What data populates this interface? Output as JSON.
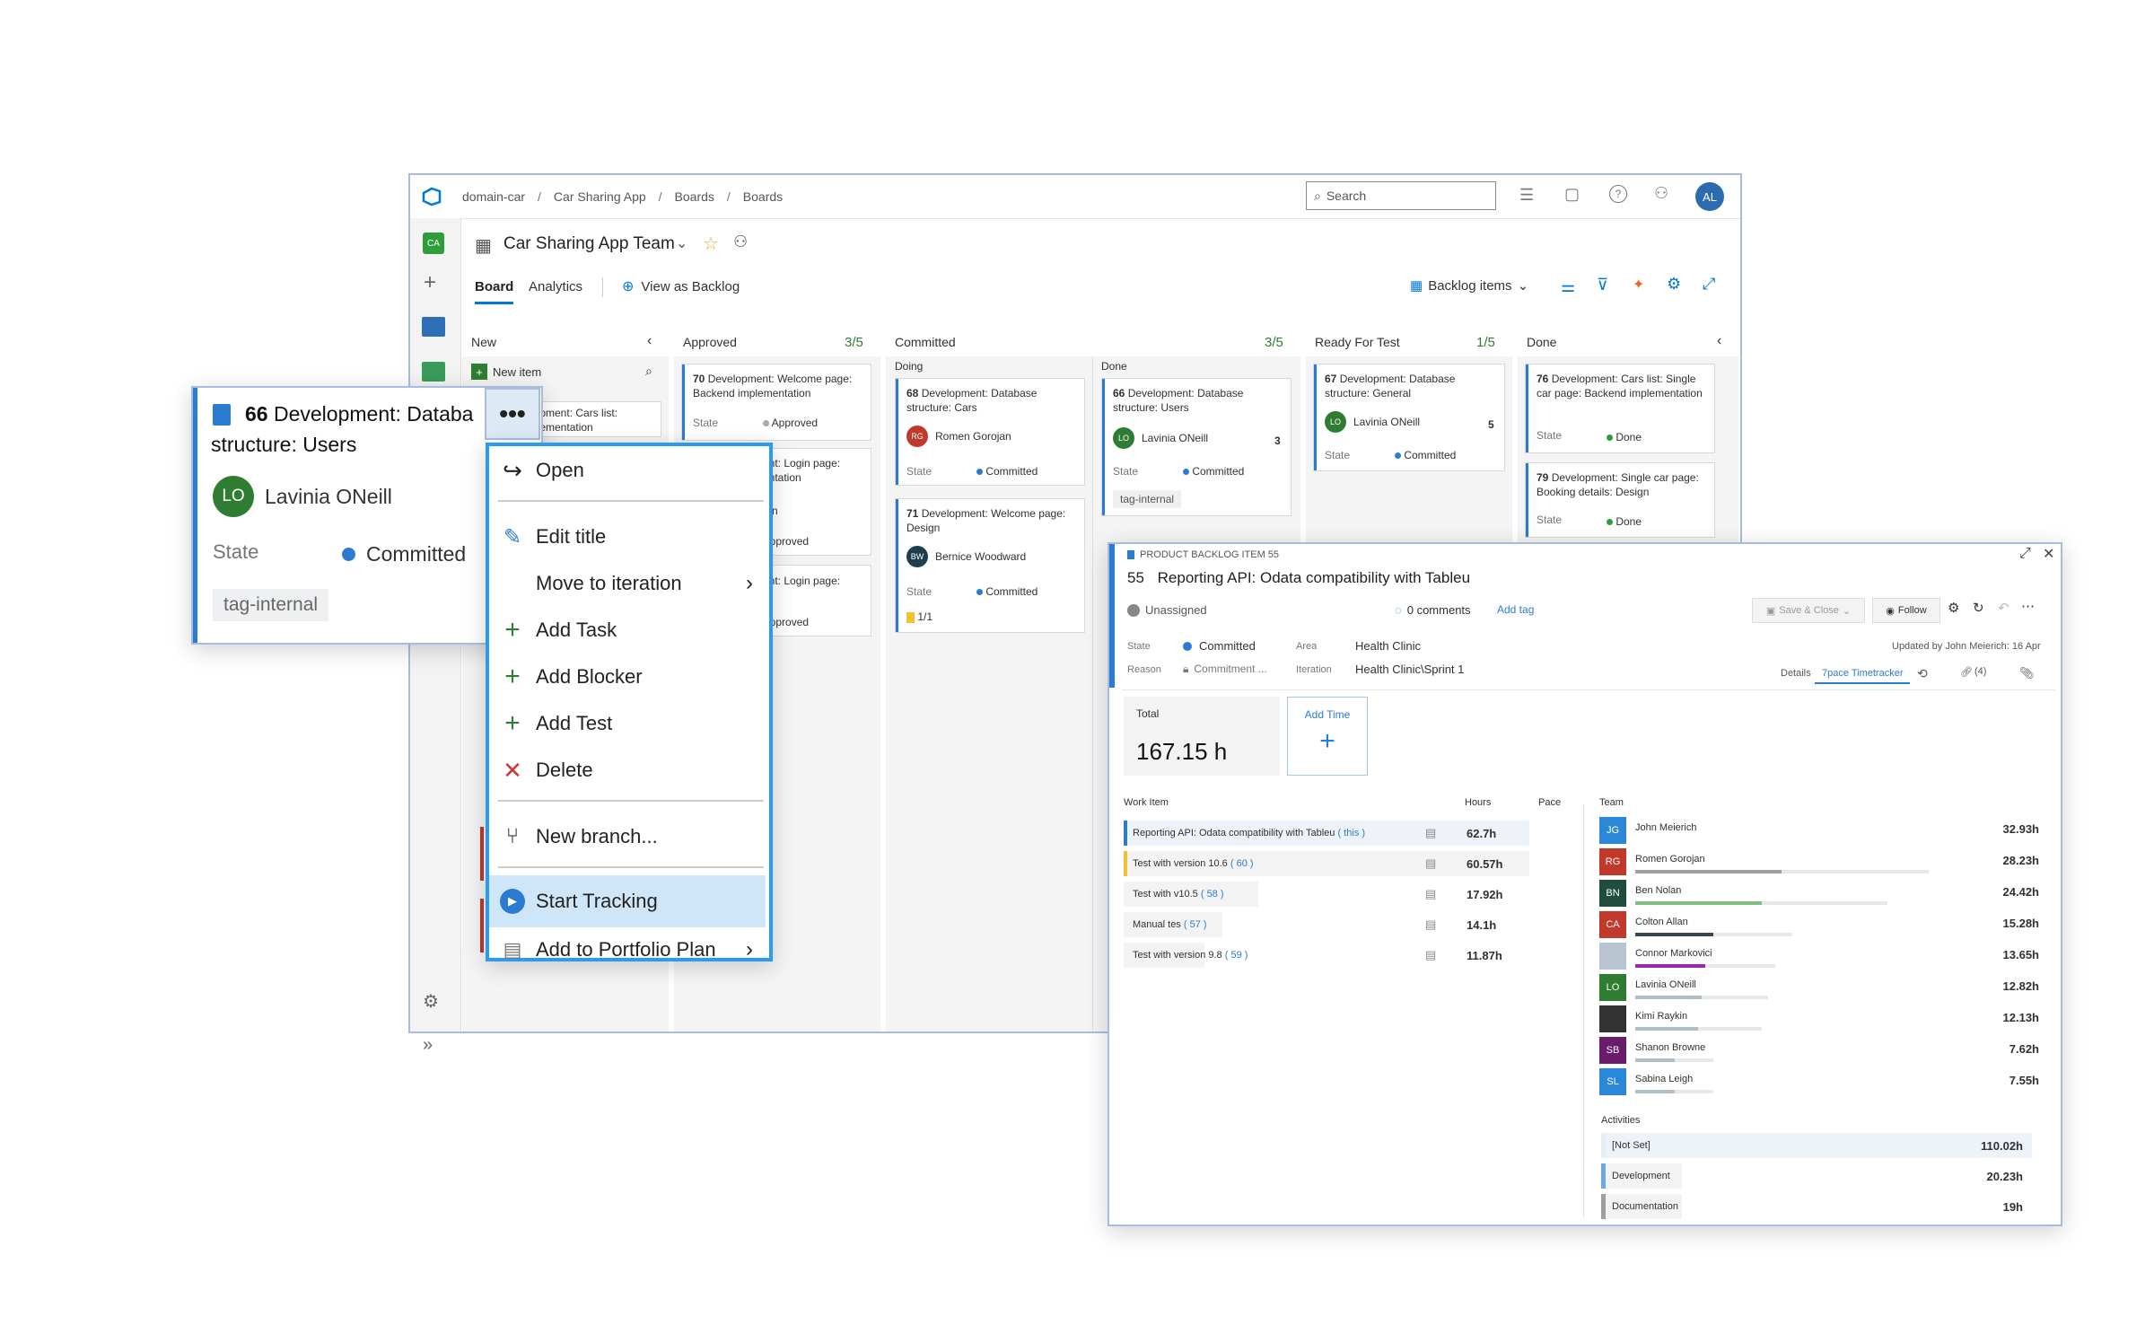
{
  "header": {
    "breadcrumb": [
      "domain-car",
      "Car Sharing App",
      "Boards",
      "Boards"
    ],
    "search_placeholder": "Search",
    "user_initials": "AL",
    "project_initials": "CA"
  },
  "board": {
    "team_name": "Car Sharing App Team",
    "tabs": [
      "Board",
      "Analytics"
    ],
    "view_as_backlog": "View as Backlog",
    "backlog_items": "Backlog items",
    "columns": [
      {
        "name": "New"
      },
      {
        "name": "Approved",
        "limit": "3/5"
      },
      {
        "name": "Committed",
        "limit": "3/5"
      },
      {
        "name": "Ready For Test",
        "limit": "1/5"
      },
      {
        "name": "Done"
      }
    ],
    "new_item": "New item",
    "doing": "Doing",
    "done": "Done",
    "state_label": "State",
    "new_cards": [
      {
        "title": "Development: Cars list: Implementation",
        "title_partial": "lopment: Cars list:",
        "title_partial2": "plementation"
      }
    ],
    "approved_cards": [
      {
        "id": "70",
        "title": "Development: Welcome page: Backend implementation",
        "state": "Approved"
      },
      {
        "title_partial": "ment: Login page:",
        "title_partial2": "mentation",
        "assignee_partial": "rojan",
        "state": "Approved"
      },
      {
        "title_partial": "ment: Login page:",
        "state": "Approved"
      }
    ],
    "committed_doing_cards": [
      {
        "id": "68",
        "title": "Development: Database structure: Cars",
        "assignee_initials": "RG",
        "assignee": "Romen Gorojan",
        "state": "Committed"
      },
      {
        "id": "71",
        "title": "Development: Welcome page: Design",
        "assignee_initials": "BW",
        "assignee": "Bernice Woodward",
        "state": "Committed",
        "tasks": "1/1"
      }
    ],
    "committed_done_cards": [
      {
        "id": "66",
        "title": "Development: Database structure: Users",
        "assignee_initials": "LO",
        "assignee": "Lavinia ONeill",
        "count": "3",
        "state": "Committed",
        "tag": "tag-internal"
      }
    ],
    "ready_cards": [
      {
        "id": "67",
        "title": "Development: Database structure: General",
        "assignee_initials": "LO",
        "assignee": "Lavinia ONeill",
        "count": "5",
        "state": "Committed"
      }
    ],
    "done_cards": [
      {
        "id": "76",
        "title": "Development: Cars list: Single car page: Backend implementation",
        "state": "Done"
      },
      {
        "id": "79",
        "title": "Development: Single car page: Booking details: Design",
        "state": "Done"
      }
    ]
  },
  "zoom_card": {
    "id": "66",
    "title_line1": "Development: Databa",
    "title_line2": "structure: Users",
    "assignee_initials": "LO",
    "assignee": "Lavinia ONeill",
    "state_label": "State",
    "state": "Committed",
    "tag": "tag-internal"
  },
  "context_menu": {
    "items": [
      {
        "label": "Open",
        "icon": "open-arrow-icon"
      },
      {
        "label": "Edit title",
        "icon": "pencil-icon"
      },
      {
        "label": "Move to iteration",
        "icon": "",
        "submenu": true
      },
      {
        "label": "Add Task",
        "icon": "plus-icon"
      },
      {
        "label": "Add Blocker",
        "icon": "plus-icon"
      },
      {
        "label": "Add Test",
        "icon": "plus-icon"
      },
      {
        "label": "Delete",
        "icon": "x-icon"
      },
      {
        "label": "New branch...",
        "icon": "branch-icon"
      },
      {
        "label": "Start Tracking",
        "icon": "play-icon"
      },
      {
        "label": "Add to Portfolio Plan",
        "icon": "plan-icon",
        "submenu": true
      }
    ]
  },
  "work_item": {
    "type_label": "PRODUCT BACKLOG ITEM 55",
    "id": "55",
    "title": "Reporting API: Odata compatibility with Tableu",
    "assignee": "Unassigned",
    "comments": "0 comments",
    "add_tag": "Add tag",
    "save_close": "Save & Close",
    "follow": "Follow",
    "state_label": "State",
    "state": "Committed",
    "reason_label": "Reason",
    "reason": "Commitment ...",
    "area_label": "Area",
    "area": "Health Clinic",
    "iteration_label": "Iteration",
    "iteration": "Health Clinic\\Sprint 1",
    "updated_by": "Updated by John Meierich: 16 Apr",
    "tabs": [
      "Details",
      "7pace Timetracker"
    ],
    "links_count": "(4)",
    "total_label": "Total",
    "total_value": "167.15 h",
    "add_time": "Add Time",
    "col_work_item": "Work Item",
    "col_hours": "Hours",
    "col_pace": "Pace",
    "col_team": "Team",
    "work_items": [
      {
        "name": "Reporting API: Odata compatibility with Tableu",
        "ref": "this",
        "hours": "62.7h",
        "color": "#2b7bd0"
      },
      {
        "name": "Test with version 10.6",
        "ref": "60",
        "hours": "60.57h",
        "color": "#f2c12e"
      },
      {
        "name": "Test with v10.5",
        "ref": "58",
        "hours": "17.92h",
        "color": "#f2c12e"
      },
      {
        "name": "Manual tes",
        "ref": "57",
        "hours": "14.1h",
        "color": "#f2c12e"
      },
      {
        "name": "Test with version 9.8",
        "ref": "59",
        "hours": "11.87h",
        "color": "#f2c12e"
      }
    ],
    "team": [
      {
        "initials": "JG",
        "name": "John Meierich",
        "hours": "32.93h",
        "color": "#2b88d8",
        "fill": 0.0
      },
      {
        "initials": "RG",
        "name": "Romen Gorojan",
        "hours": "28.23h",
        "color": "#c0392b",
        "fill": 0.86
      },
      {
        "initials": "BN",
        "name": "Ben Nolan",
        "hours": "24.42h",
        "color": "#1f4e3d",
        "fill": 0.74
      },
      {
        "initials": "CA",
        "name": "Colton Allan",
        "hours": "15.28h",
        "color": "#c0392b",
        "fill": 0.46
      },
      {
        "initials": "",
        "name": "Connor Markovici",
        "hours": "13.65h",
        "color": "#b8c4d0",
        "fill": 0.41
      },
      {
        "initials": "LO",
        "name": "Lavinia ONeill",
        "hours": "12.82h",
        "color": "#2e7d32",
        "fill": 0.39
      },
      {
        "initials": "",
        "name": "Kimi Raykin",
        "hours": "12.13h",
        "color": "#333333",
        "fill": 0.37
      },
      {
        "initials": "SB",
        "name": "Shanon Browne",
        "hours": "7.62h",
        "color": "#6a1b6a",
        "fill": 0.23
      },
      {
        "initials": "SL",
        "name": "Sabina Leigh",
        "hours": "7.55h",
        "color": "#2b88d8",
        "fill": 0.23
      }
    ],
    "activities_label": "Activities",
    "activities": [
      {
        "name": "[Not Set]",
        "hours": "110.02h",
        "color": "#e8eef6"
      },
      {
        "name": "Development",
        "hours": "20.23h",
        "color": "#6fa8dc"
      },
      {
        "name": "Documentation",
        "hours": "19h",
        "color": "#9e9e9e"
      }
    ]
  }
}
